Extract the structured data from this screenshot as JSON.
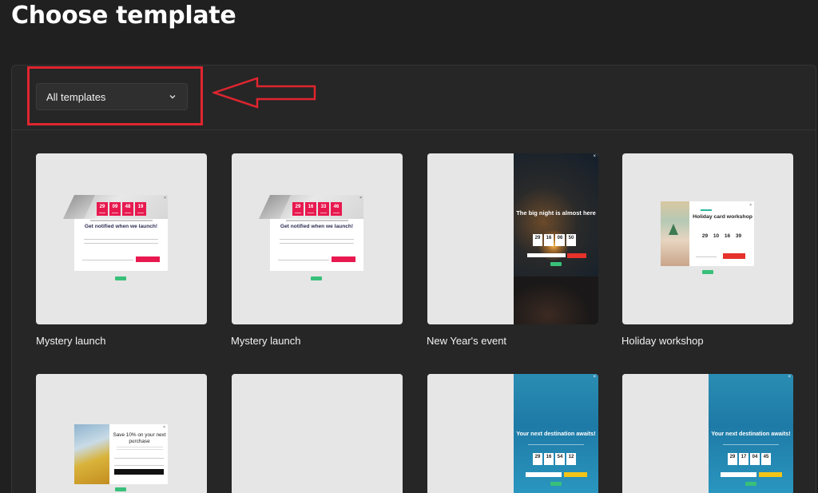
{
  "page": {
    "title": "Choose template"
  },
  "filter": {
    "selected": "All templates",
    "icon": "chevron-down-icon"
  },
  "colors": {
    "annotation": "#e0252f",
    "accent_pink": "#e8194f",
    "accent_red": "#e5322b",
    "accent_green": "#38c07a",
    "accent_yellow": "#f3c417"
  },
  "templates": [
    {
      "name": "Mystery launch",
      "preview": {
        "countdown": [
          "29",
          "09",
          "48",
          "19"
        ],
        "heading": "Get notified when we launch!"
      }
    },
    {
      "name": "Mystery launch",
      "preview": {
        "countdown": [
          "29",
          "16",
          "33",
          "46"
        ],
        "heading": "Get notified when we launch!"
      }
    },
    {
      "name": "New Year's event",
      "preview": {
        "countdown": [
          "29",
          "16",
          "06",
          "50"
        ],
        "heading": "The big night is almost here"
      }
    },
    {
      "name": "Holiday workshop",
      "preview": {
        "countdown": [
          "29",
          "10",
          "16",
          "39"
        ],
        "heading": "Holiday card workshop"
      }
    },
    {
      "name": "",
      "preview": {
        "heading": "Save 10% on your next purchase"
      }
    },
    {
      "name": "",
      "preview": {}
    },
    {
      "name": "",
      "preview": {
        "countdown": [
          "29",
          "16",
          "54",
          "12"
        ],
        "heading": "Your next destination awaits!"
      }
    },
    {
      "name": "",
      "preview": {
        "countdown": [
          "29",
          "17",
          "04",
          "45"
        ],
        "heading": "Your next destination awaits!"
      }
    }
  ]
}
